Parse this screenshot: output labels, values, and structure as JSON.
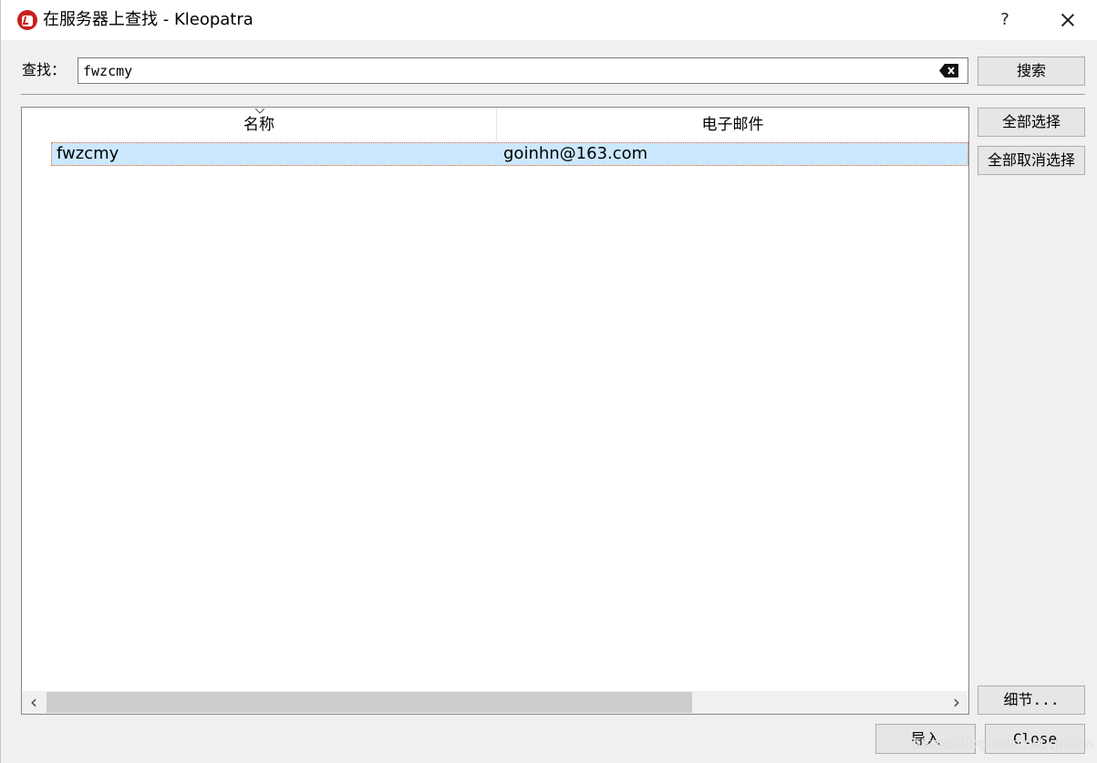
{
  "window": {
    "title": "在服务器上查找 - Kleopatra",
    "help_label": "?"
  },
  "search": {
    "label": "查找：",
    "value": "fwzcmy",
    "button_label": "搜索"
  },
  "table": {
    "columns": [
      "名称",
      "电子邮件"
    ],
    "rows": [
      {
        "name": "fwzcmy",
        "email": "goinhn@163.com",
        "selected": true
      }
    ]
  },
  "scrollbar": {
    "left_arrow": "‹",
    "right_arrow": "›"
  },
  "side_buttons": {
    "select_all": "全部选择",
    "deselect_all": "全部取消选择",
    "details": "细节..."
  },
  "footer": {
    "import_label": "导入",
    "close_label": "Close"
  },
  "watermark": "https://blog.csdn.net/goinhn",
  "colors": {
    "selection": "#cce8ff",
    "app_icon": "#c8201c"
  }
}
